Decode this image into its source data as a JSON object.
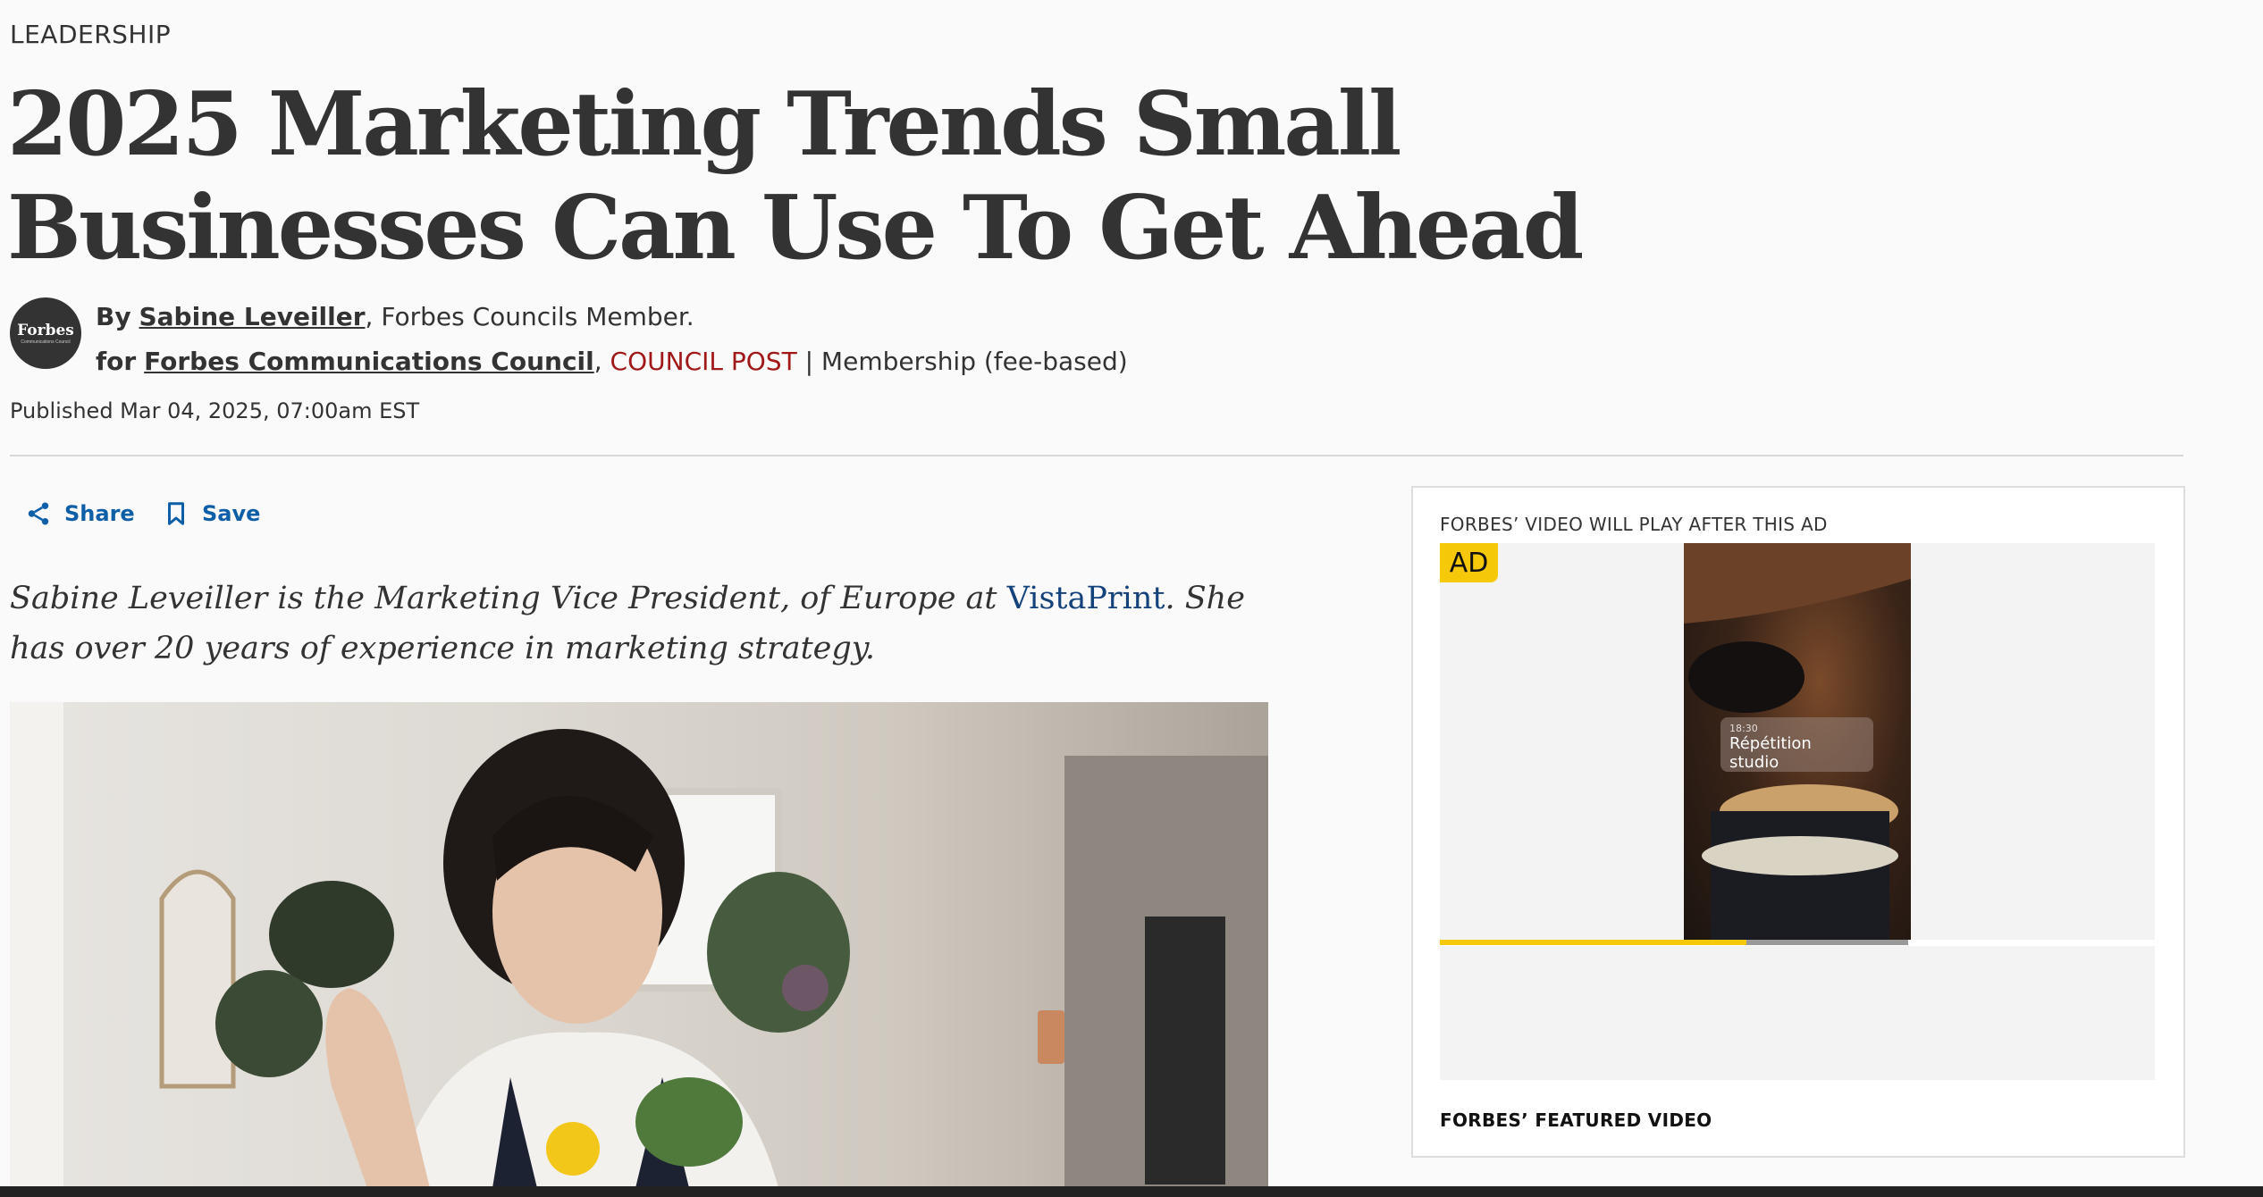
{
  "section": "LEADERSHIP",
  "headline": "2025 Marketing Trends Small Businesses Can Use To Get Ahead",
  "avatar": {
    "logo": "Forbes",
    "sub": "Communications Council"
  },
  "byline": {
    "by_prefix": "By",
    "author": "Sabine Leveiller",
    "author_suffix": ", Forbes Councils Member.",
    "for_prefix": "for",
    "council": "Forbes Communications Council",
    "comma": ",",
    "post_type": "COUNCIL POST",
    "membership": "| Membership (fee-based)"
  },
  "published": "Published Mar 04, 2025, 07:00am EST",
  "actions": {
    "share": "Share",
    "save": "Save"
  },
  "intro": {
    "before_link": "Sabine Leveiller is the Marketing Vice President, of Europe at ",
    "link": "VistaPrint",
    "after_link": ". She has over 20 years of experience in marketing strategy."
  },
  "video": {
    "label": "FORBES’ VIDEO WILL PLAY AFTER THIS AD",
    "ad_badge": "AD",
    "chip_time": "18:30",
    "chip_title": "Répétition studio",
    "progress": 0.655,
    "featured": "FORBES’ FEATURED VIDEO"
  },
  "colors": {
    "link_blue": "#0e5fa8",
    "council_red": "#a01818",
    "ad_yellow": "#f5c90a"
  }
}
